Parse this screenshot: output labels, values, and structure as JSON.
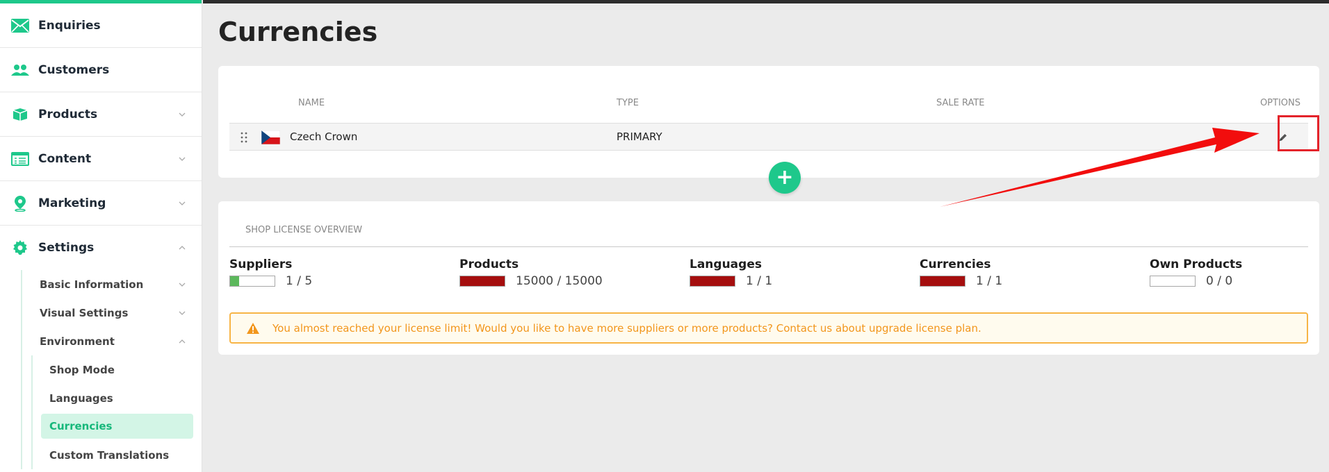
{
  "sidebar": {
    "items": [
      {
        "label": "Enquiries",
        "icon": "envelope-icon"
      },
      {
        "label": "Customers",
        "icon": "users-icon"
      },
      {
        "label": "Products",
        "icon": "box-icon"
      },
      {
        "label": "Content",
        "icon": "list-icon"
      },
      {
        "label": "Marketing",
        "icon": "map-pin-icon"
      },
      {
        "label": "Settings",
        "icon": "gear-icon"
      }
    ],
    "settings_sub": [
      {
        "label": "Basic Information"
      },
      {
        "label": "Visual Settings"
      },
      {
        "label": "Environment"
      }
    ],
    "environment_sub": [
      {
        "label": "Shop Mode"
      },
      {
        "label": "Languages"
      },
      {
        "label": "Currencies"
      },
      {
        "label": "Custom Translations"
      }
    ]
  },
  "page": {
    "title": "Currencies"
  },
  "currency_table": {
    "headers": {
      "name": "NAME",
      "type": "TYPE",
      "sale_rate": "SALE RATE",
      "options": "OPTIONS"
    },
    "rows": [
      {
        "name": "Czech Crown",
        "type": "PRIMARY",
        "sale_rate": "",
        "flag": "czech-flag-icon"
      }
    ]
  },
  "license": {
    "title": "SHOP LICENSE OVERVIEW",
    "items": [
      {
        "name": "Suppliers",
        "value": "1 / 5",
        "fill_fraction": 0.2,
        "color": "#5cb85c"
      },
      {
        "name": "Products",
        "value": "15000 / 15000",
        "fill_fraction": 1.0,
        "color": "#a50e0e"
      },
      {
        "name": "Languages",
        "value": "1 / 1",
        "fill_fraction": 1.0,
        "color": "#a50e0e"
      },
      {
        "name": "Currencies",
        "value": "1 / 1",
        "fill_fraction": 1.0,
        "color": "#a50e0e"
      },
      {
        "name": "Own Products",
        "value": "0 / 0",
        "fill_fraction": 0.0,
        "color": "#a50e0e"
      }
    ],
    "warning": "You almost reached your license limit! Would you like to have more suppliers or more products? Contact us about upgrade license plan."
  },
  "colors": {
    "accent": "#1ec88b",
    "danger": "#a50e0e",
    "warning": "#f2961c",
    "annotation": "#e4232a"
  }
}
